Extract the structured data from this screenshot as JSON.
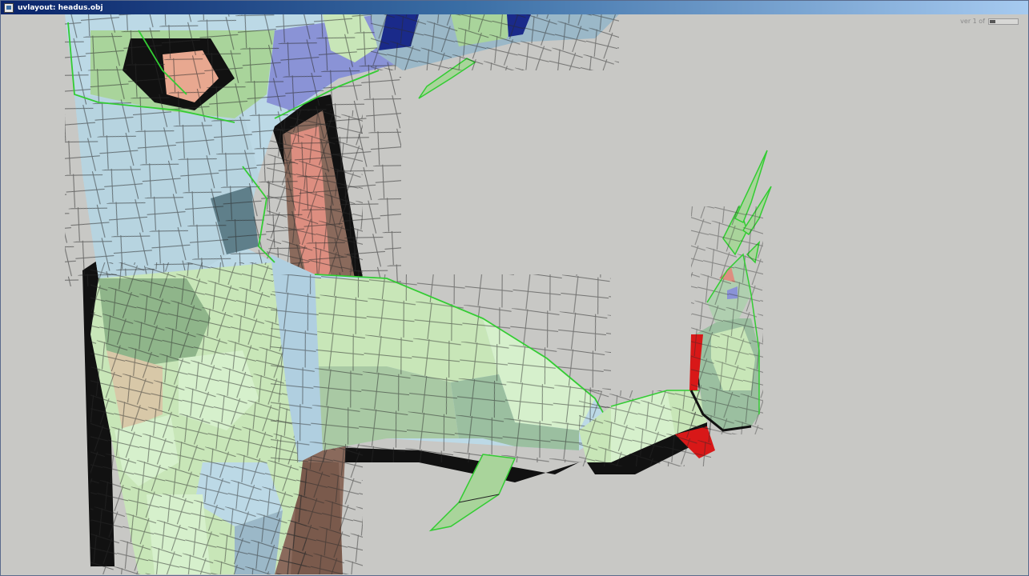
{
  "window": {
    "title": "uvlayout: headus.obj",
    "icon": "uvlayout-app-icon"
  },
  "status": {
    "label": "ver 1 of"
  },
  "viewport": {
    "background_color": "#c8c8c5",
    "edge_color": "#33cc33",
    "wire_color": "#222222",
    "face_colors": {
      "light_green": "#c8e6b8",
      "green": "#a9d49b",
      "mint": "#d6f0cc",
      "pale_blue": "#bcd9e6",
      "blue_gray": "#9bb8c8",
      "slate": "#7a9a9e",
      "peach": "#e8a890",
      "salmon": "#dd8e80",
      "tan": "#d8c8a8",
      "brown": "#8a6a5c",
      "dark_brown": "#5a4038",
      "periwinkle": "#8a93d6",
      "navy": "#1a2a8a",
      "red": "#d81818",
      "black": "#111111"
    }
  }
}
